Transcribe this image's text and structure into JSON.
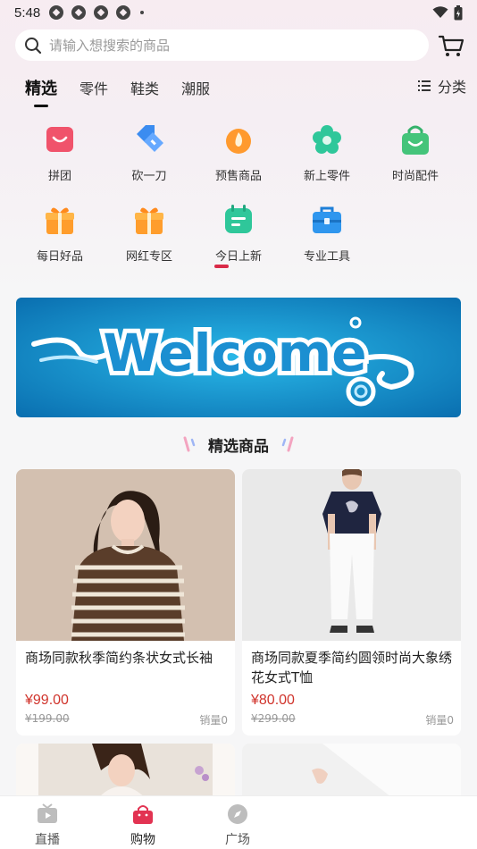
{
  "status_bar": {
    "time": "5:48"
  },
  "search": {
    "placeholder": "请输入想搜索的商品"
  },
  "tabs": [
    {
      "label": "精选",
      "active": true
    },
    {
      "label": "零件",
      "active": false
    },
    {
      "label": "鞋类",
      "active": false
    },
    {
      "label": "潮服",
      "active": false
    }
  ],
  "category_label": "分类",
  "menu": [
    {
      "label": "拼团",
      "icon": "smile-bag-icon"
    },
    {
      "label": "砍一刀",
      "icon": "tag-icon"
    },
    {
      "label": "预售商品",
      "icon": "flame-icon"
    },
    {
      "label": "新上零件",
      "icon": "flower-icon"
    },
    {
      "label": "时尚配件",
      "icon": "shopping-bag-icon"
    },
    {
      "label": "每日好品",
      "icon": "gift-icon"
    },
    {
      "label": "网红专区",
      "icon": "gift-icon"
    },
    {
      "label": "今日上新",
      "icon": "calendar-icon"
    },
    {
      "label": "专业工具",
      "icon": "toolbox-icon"
    }
  ],
  "banner": {
    "text": "Welcome"
  },
  "section_title": "精选商品",
  "products": [
    {
      "title": "商场同款秋季简约条状女式长袖",
      "price": "¥99.00",
      "original_price": "¥199.00",
      "sales": "销量0"
    },
    {
      "title": "商场同款夏季简约圆领时尚大象绣花女式T恤",
      "price": "¥80.00",
      "original_price": "¥299.00",
      "sales": "销量0"
    }
  ],
  "bottom_nav": [
    {
      "label": "直播",
      "icon": "tv-icon",
      "active": false
    },
    {
      "label": "购物",
      "icon": "shopping-bag-icon",
      "active": true
    },
    {
      "label": "广场",
      "icon": "compass-icon",
      "active": false
    }
  ],
  "colors": {
    "accent": "#d92a48",
    "price": "#d0342c"
  }
}
